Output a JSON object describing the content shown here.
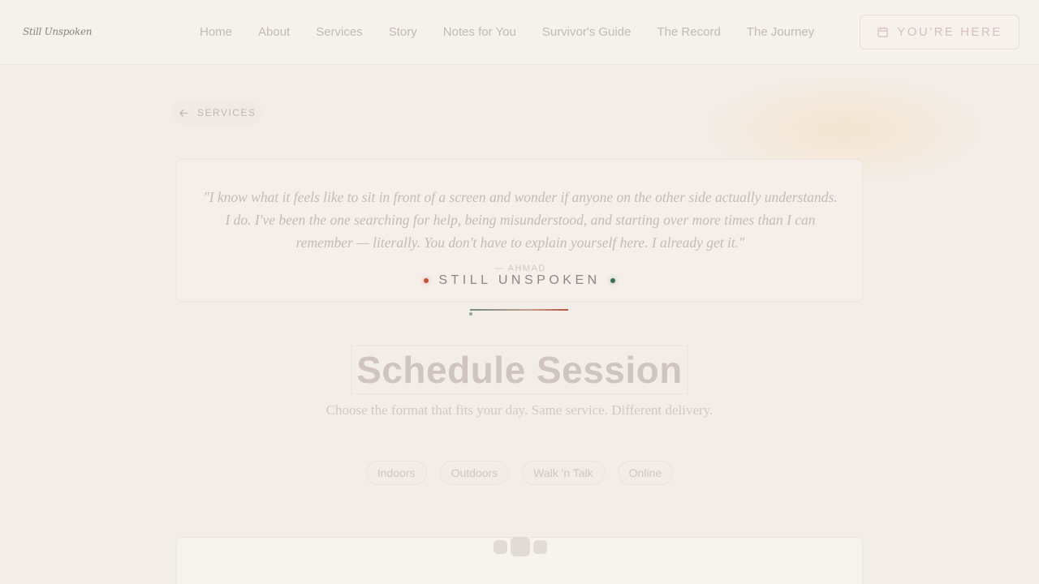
{
  "header": {
    "logo": "Still Unspoken",
    "nav": [
      "Home",
      "About",
      "Services",
      "Story",
      "Notes for You",
      "Survivor's Guide",
      "The Record",
      "The Journey"
    ],
    "cta_label": "YOU'RE HERE",
    "cta_icon": "calendar-icon"
  },
  "back_link": {
    "label": "SERVICES",
    "icon": "arrow-left-icon"
  },
  "quote": {
    "text": "\"I know what it feels like to sit in front of a screen and wonder if anyone on the other side actually understands. I do. I've been the one searching for help, being misunderstood, and starting over more times than I can remember — literally. You don't have to explain yourself here. I already get it.\"",
    "author": "— AHMAD"
  },
  "brand": {
    "text": "STILL UNSPOKEN",
    "accent_red": "#c0533c",
    "accent_green": "#3f6b5c"
  },
  "main": {
    "title": "Schedule Session",
    "subtitle": "Choose the format that fits your day. Same service. Different delivery.",
    "formats": [
      "Indoors",
      "Outdoors",
      "Walk 'n Talk",
      "Online"
    ]
  }
}
